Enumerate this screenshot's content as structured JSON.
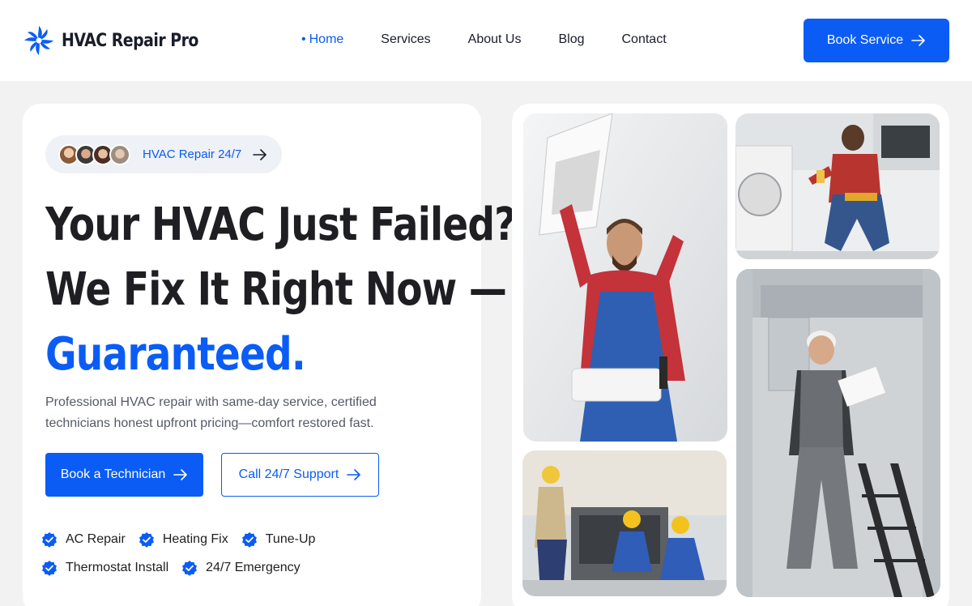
{
  "header": {
    "brand": "HVAC Repair Pro",
    "nav": [
      {
        "label": "Home",
        "active": true
      },
      {
        "label": "Services",
        "active": false
      },
      {
        "label": "About Us",
        "active": false
      },
      {
        "label": "Blog",
        "active": false
      },
      {
        "label": "Contact",
        "active": false
      }
    ],
    "cta_label": "Book Service"
  },
  "hero": {
    "badge_text": "HVAC Repair 24/7",
    "headline_line1": "Your HVAC Just Failed?",
    "headline_line2": "We Fix It Right Now —",
    "headline_accent": "Guaranteed.",
    "subtext": "Professional HVAC repair with same-day service, certified technicians honest upfront pricing—comfort restored fast.",
    "primary_cta": "Book a Technician",
    "secondary_cta": "Call 24/7 Support",
    "features": [
      "AC Repair",
      "Heating Fix",
      "Tune-Up",
      "Thermostat Install",
      "24/7 Emergency"
    ]
  },
  "colors": {
    "accent": "#0a5cf5",
    "heading": "#1f1f23",
    "background": "#f2f2f2"
  },
  "icons": {
    "logo": "fan-logo-icon",
    "arrow": "arrow-right-icon",
    "check": "verified-check-icon"
  }
}
